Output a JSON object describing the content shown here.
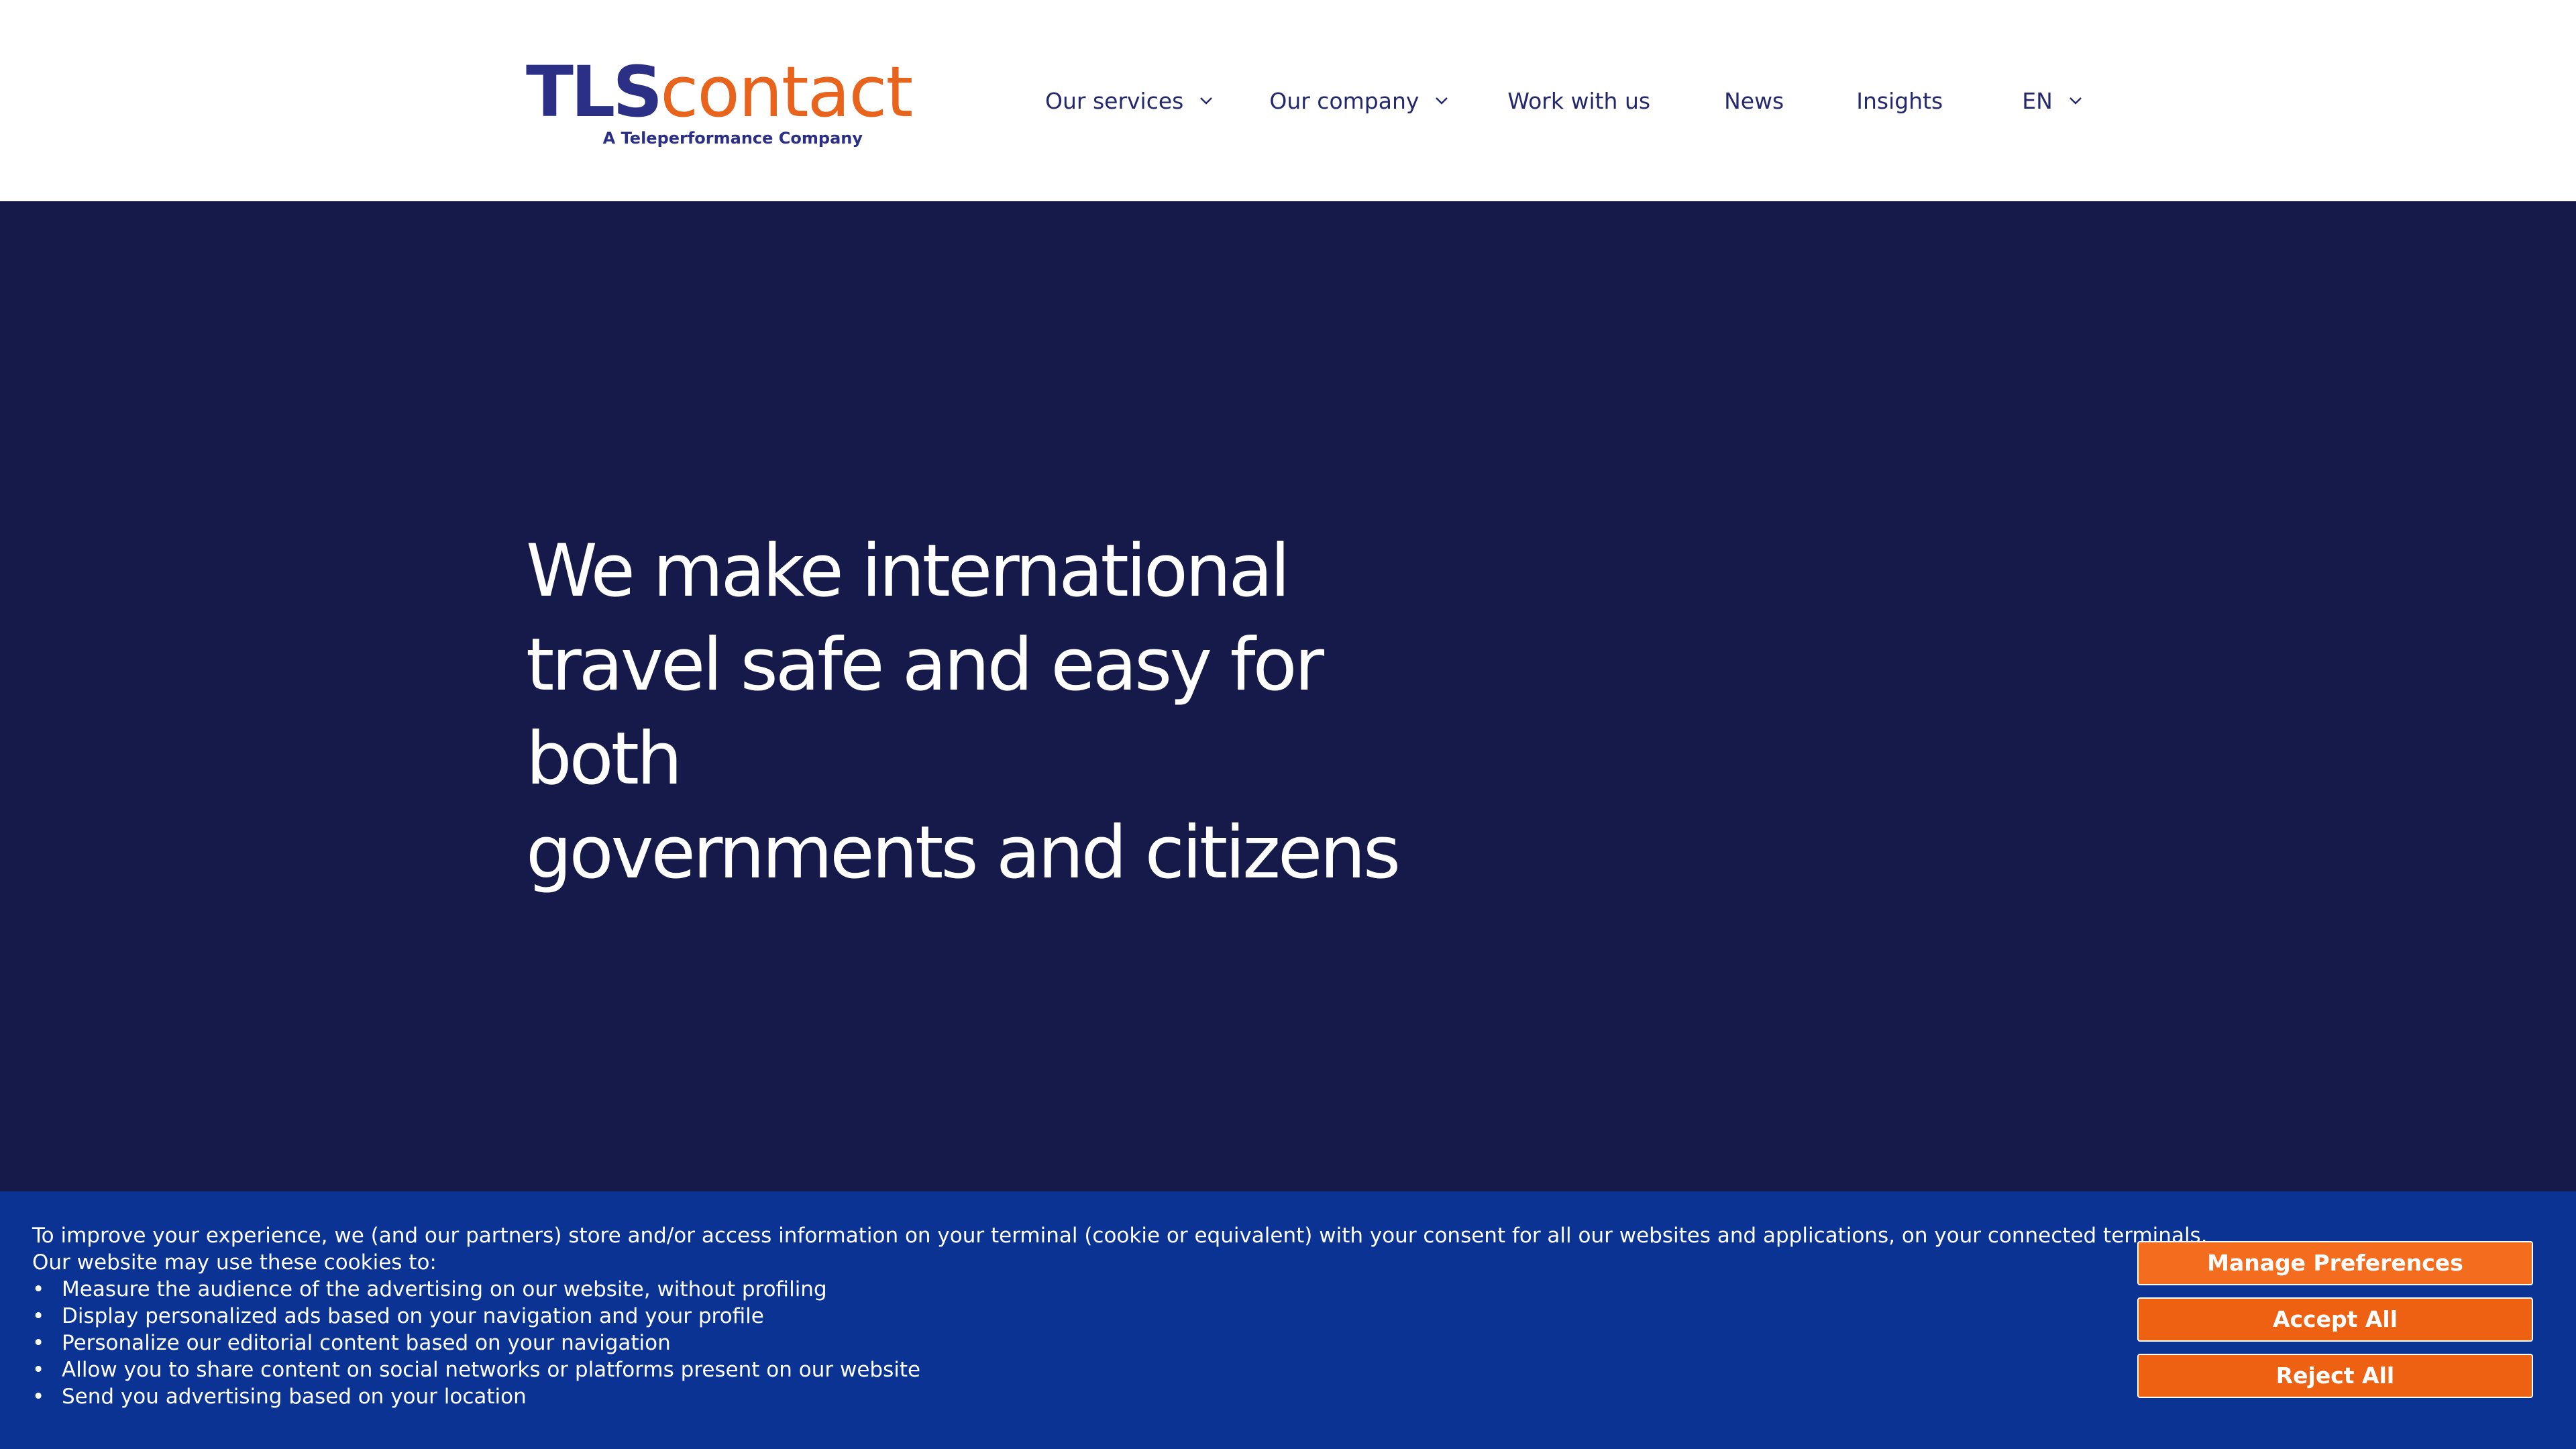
{
  "logo": {
    "brand_bold": "TLS",
    "brand_light": "contact",
    "tagline": "A Teleperformance Company"
  },
  "nav": {
    "items": [
      {
        "label": "Our services",
        "has_dropdown": true
      },
      {
        "label": "Our company",
        "has_dropdown": true
      },
      {
        "label": "Work with us",
        "has_dropdown": false
      },
      {
        "label": "News",
        "has_dropdown": false
      },
      {
        "label": "Insights",
        "has_dropdown": false
      }
    ],
    "language": {
      "label": "EN",
      "has_dropdown": true
    }
  },
  "hero": {
    "title_lines": [
      "We make international",
      "travel safe and easy for both",
      "governments and citizens"
    ]
  },
  "cookie_banner": {
    "intro": "To improve your experience, we (and our partners) store and/or access information on your terminal (cookie or equivalent) with your consent for all our websites and applications, on your connected terminals.",
    "lead": "Our website may use these cookies to:",
    "bullet_glyph": "•",
    "items": [
      "Measure the audience of the advertising on our website, without profiling",
      "Display personalized ads based on your navigation and your profile",
      "Personalize our editorial content based on your navigation",
      "Allow you to share content on social networks or platforms present on our website",
      "Send you advertising based on your location"
    ],
    "buttons": {
      "manage": "Manage Preferences",
      "accept": "Accept All",
      "reject": "Reject All"
    }
  },
  "colors": {
    "navy": "#151a4a",
    "brand_blue": "#2b2f86",
    "brand_orange": "#e8641c",
    "banner_blue": "#0a3393",
    "button_orange": "#ee6112"
  },
  "icons": {
    "dropdown": "chevron-down-icon"
  }
}
